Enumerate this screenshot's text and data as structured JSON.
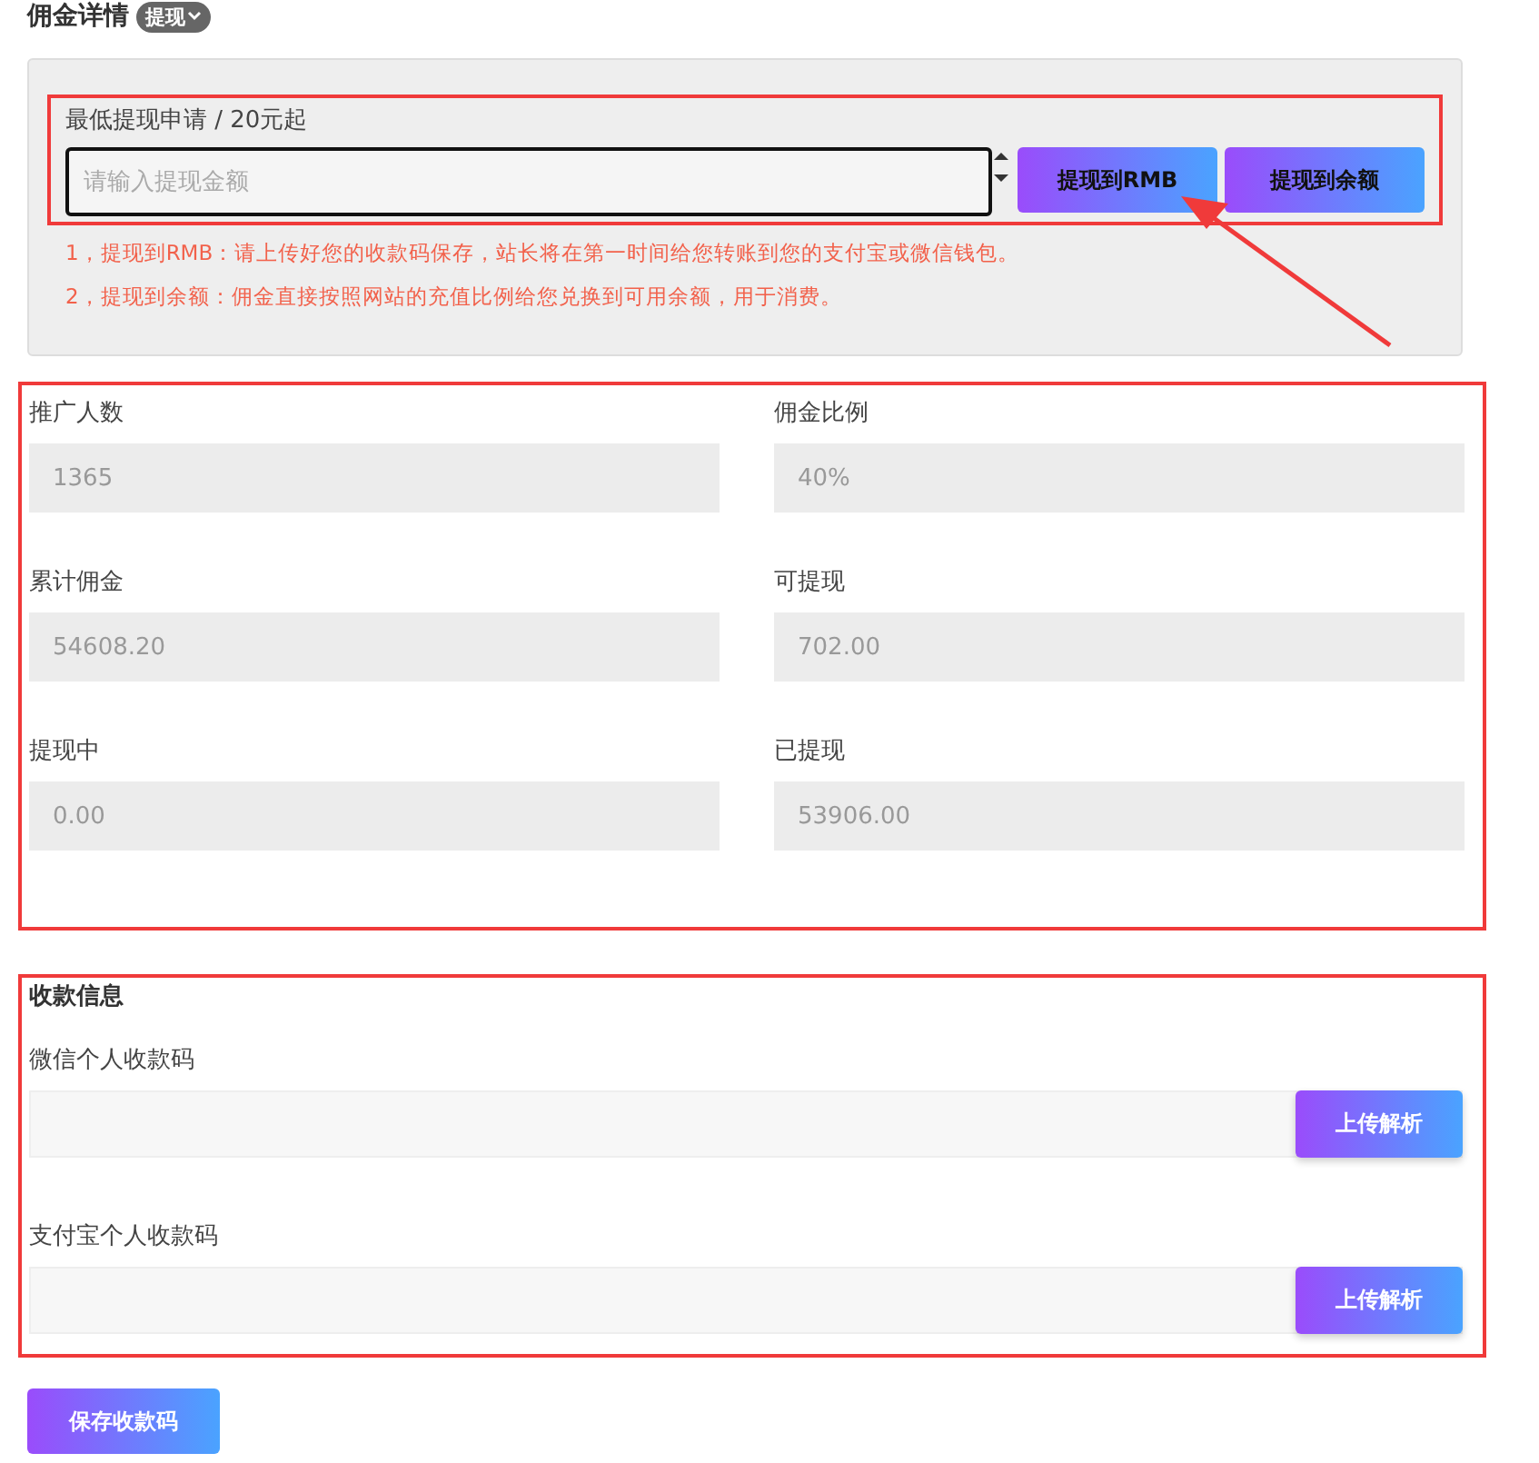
{
  "header": {
    "title": "佣金详情",
    "badge": "提现"
  },
  "withdraw": {
    "label": "最低提现申请 / 20元起",
    "placeholder": "请输入提现金额",
    "buttons": [
      "提现到RMB",
      "提现到余额"
    ],
    "notes": [
      "1，提现到RMB：请上传好您的收款码保存，站长将在第一时间给您转账到您的支付宝或微信钱包。",
      "2，提现到余额：佣金直接按照网站的充值比例给您兑换到可用余额，用于消费。"
    ]
  },
  "stats": [
    {
      "label": "推广人数",
      "value": "1365"
    },
    {
      "label": "佣金比例",
      "value": "40%"
    },
    {
      "label": "累计佣金",
      "value": "54608.20"
    },
    {
      "label": "可提现",
      "value": "702.00"
    },
    {
      "label": "提现中",
      "value": "0.00"
    },
    {
      "label": "已提现",
      "value": "53906.00"
    }
  ],
  "payment": {
    "title": "收款信息",
    "fields": [
      {
        "label": "微信个人收款码",
        "button": "上传解析"
      },
      {
        "label": "支付宝个人收款码",
        "button": "上传解析"
      }
    ]
  },
  "save_button": "保存收款码"
}
